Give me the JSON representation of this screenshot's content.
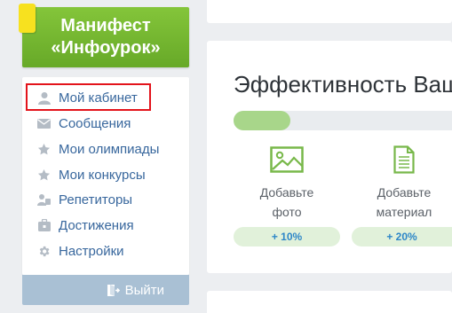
{
  "sidebar": {
    "manifest_line1": "Манифест",
    "manifest_line2": "«Инфоурок»",
    "items": [
      {
        "label": "Мой кабинет",
        "icon": "user-icon"
      },
      {
        "label": "Сообщения",
        "icon": "envelope-icon"
      },
      {
        "label": "Мои олимпиады",
        "icon": "star-icon"
      },
      {
        "label": "Мои конкурсы",
        "icon": "star-icon"
      },
      {
        "label": "Репетиторы",
        "icon": "tutor-icon"
      },
      {
        "label": "Достижения",
        "icon": "briefcase-icon"
      },
      {
        "label": "Настройки",
        "icon": "gear-icon"
      }
    ],
    "logout_label": "Выйти"
  },
  "effectiveness": {
    "title": "Эффективность Ваш",
    "progress_fraction": 0.26,
    "actions": [
      {
        "label_line1": "Добавьте",
        "label_line2": "фото",
        "bonus": "+ 10%",
        "icon": "image-icon"
      },
      {
        "label_line1": "Добавьте",
        "label_line2": "материал",
        "bonus": "+ 20%",
        "icon": "document-icon"
      }
    ]
  },
  "colors": {
    "accent_green": "#72b52f",
    "link_blue": "#38679d",
    "highlight_red": "#e3131b",
    "bonus_blue": "#2e87c8"
  }
}
